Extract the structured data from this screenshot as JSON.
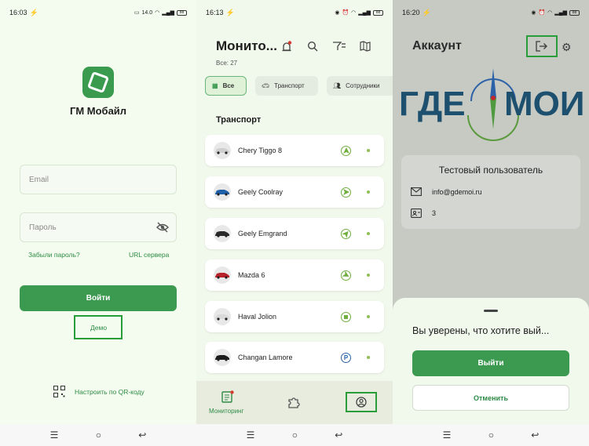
{
  "login": {
    "status": {
      "time": "16:03",
      "battery": "88"
    },
    "app_title": "ГМ Мобайл",
    "email_placeholder": "Email",
    "password_placeholder": "Пароль",
    "forgot_password": "Забыли пароль?",
    "server_url": "URL сервера",
    "login_button": "Войти",
    "demo_link": "Демо",
    "qr_setup": "Настроить по QR-коду"
  },
  "monitoring": {
    "status": {
      "time": "16:13",
      "battery": "88"
    },
    "title": "Монито...",
    "count": "Все: 27",
    "chips": [
      {
        "label": "Все",
        "icon": "grid-icon"
      },
      {
        "label": "Транспорт",
        "icon": "car-icon"
      },
      {
        "label": "Сотрудники",
        "icon": "people-icon"
      }
    ],
    "section": "Транспорт",
    "vehicles": [
      {
        "name": "Chery Tiggo 8",
        "status_icon": "arrow-direction-icon",
        "car_color": "#cfcfcf"
      },
      {
        "name": "Geely Coolray",
        "status_icon": "arrow-direction-icon",
        "car_color": "#1f5fa8"
      },
      {
        "name": "Geely Emgrand",
        "status_icon": "arrow-direction-icon",
        "car_color": "#2a2a2a"
      },
      {
        "name": "Mazda 6",
        "status_icon": "arrow-direction-icon",
        "car_color": "#b8202a"
      },
      {
        "name": "Haval Jolion",
        "status_icon": "stop-icon",
        "car_color": "#d9d9d9"
      },
      {
        "name": "Changan Lamore",
        "status_icon": "parking-icon",
        "car_color": "#1c1c1c"
      }
    ],
    "tab_monitoring": "Мониторинг"
  },
  "account": {
    "status": {
      "time": "16:20",
      "battery": "88"
    },
    "title": "Аккаунт",
    "brand_left": "ГДЕ",
    "brand_right": "МОИ",
    "user_name": "Тестовый пользователь",
    "email": "info@gdemoi.ru",
    "user_id": "3",
    "confirm_question": "Вы уверены, что хотите вый...",
    "logout_button": "Выйти",
    "cancel_button": "Отменить"
  },
  "colors": {
    "accent": "#3b9a50",
    "highlight": "#2a9d3b",
    "brand_blue": "#1e4fa3"
  }
}
